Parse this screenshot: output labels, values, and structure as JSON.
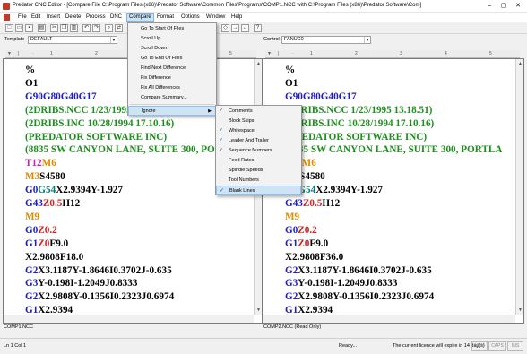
{
  "window": {
    "title": "Predator CNC Editor - [Compare File C:\\Program Files (x86)\\Predator Software\\Common Files\\Programs\\COMP1.NCC with C:\\Program Files (x86)\\Predator Software\\Com]",
    "controls": {
      "minimize": "–",
      "maximize": "▢",
      "close": "✕"
    }
  },
  "menubar": {
    "items": [
      "File",
      "Edit",
      "Insert",
      "Delete",
      "Process",
      "DNC",
      "Compare",
      "Format",
      "Options",
      "Window",
      "Help"
    ],
    "active": "Compare"
  },
  "toolbar": {
    "buttons": [
      "new",
      "open",
      "save",
      "print",
      "cut",
      "copy",
      "paste",
      "undo",
      "redo",
      "find",
      "replace",
      "renumber",
      "compare",
      "backplot",
      "send",
      "receive",
      "help"
    ]
  },
  "template": {
    "label": "Template",
    "value": "DEFAULT",
    "control_label": "Control",
    "control_value": "FANUC0"
  },
  "compare_menu": {
    "items": [
      "Go To Start Of Files",
      "Scroll Up",
      "Scroll Down",
      "Go To End Of Files",
      "Find Next Difference",
      "Fix Difference",
      "Fix All Differences",
      "Compare Summary...",
      "Ignore"
    ],
    "highlighted": "Ignore"
  },
  "ignore_submenu": {
    "items": [
      {
        "label": "Comments",
        "checked": true
      },
      {
        "label": "Block Skips",
        "checked": false
      },
      {
        "label": "Whitespace",
        "checked": true
      },
      {
        "label": "Leader And Trailer",
        "checked": true
      },
      {
        "label": "Sequence Numbers",
        "checked": true
      },
      {
        "label": "Feed Rates",
        "checked": false
      },
      {
        "label": "Spindle Speeds",
        "checked": false
      },
      {
        "label": "Tool Numbers",
        "checked": false
      },
      {
        "label": "Blank Lines",
        "checked": true
      }
    ],
    "highlighted": "Blank Lines"
  },
  "colors": {
    "default": "#000000",
    "blue": "#1c1cc8",
    "green": "#1f8f1f",
    "magenta": "#c81ec8",
    "red": "#d21e1e",
    "orange": "#e08a00",
    "teal": "#007a7a",
    "menu_highlight": "#cce4f7"
  },
  "left_file": {
    "label": "COMP1.NCC",
    "lines": [
      [
        {
          "t": "%",
          "c": "default"
        }
      ],
      [
        {
          "t": "O1",
          "c": "default"
        }
      ],
      [
        {
          "t": "G90G80G40G17",
          "c": "blue"
        }
      ],
      [
        {
          "t": "(2DRIBS.NCC 1/23/1995 13.18.51)",
          "c": "green"
        }
      ],
      [
        {
          "t": "(2DRIBS.INC 10/28/1994 17.10.16)",
          "c": "green"
        }
      ],
      [
        {
          "t": "(PREDATOR SOFTWARE INC)",
          "c": "green"
        }
      ],
      [
        {
          "t": "(8835 SW CANYON LANE, SUITE 300, PORTLA",
          "c": "green"
        }
      ],
      [
        {
          "t": "T12",
          "c": "magenta"
        },
        {
          "t": "M6",
          "c": "orange"
        }
      ],
      [
        {
          "t": "M3",
          "c": "orange"
        },
        {
          "t": "S4580",
          "c": "default"
        }
      ],
      [
        {
          "t": "G0",
          "c": "blue"
        },
        {
          "t": "G54",
          "c": "teal"
        },
        {
          "t": "X2.9394Y-1.927",
          "c": "default"
        }
      ],
      [
        {
          "t": "G43",
          "c": "blue"
        },
        {
          "t": "Z0.5",
          "c": "red"
        },
        {
          "t": "H12",
          "c": "default"
        }
      ],
      [
        {
          "t": "M9",
          "c": "orange"
        }
      ],
      [
        {
          "t": "G0",
          "c": "blue"
        },
        {
          "t": "Z0.2",
          "c": "red"
        }
      ],
      [
        {
          "t": "G1",
          "c": "blue"
        },
        {
          "t": "Z0",
          "c": "red"
        },
        {
          "t": "F9.0",
          "c": "default"
        }
      ],
      [
        {
          "t": "X2.9808F18.0",
          "c": "default"
        }
      ],
      [
        {
          "t": "G2",
          "c": "blue"
        },
        {
          "t": "X3.1187Y-1.8646I0.3702J-0.635",
          "c": "default"
        }
      ],
      [
        {
          "t": "G3",
          "c": "blue"
        },
        {
          "t": "Y-0.198I-1.2049J0.8333",
          "c": "default"
        }
      ],
      [
        {
          "t": "G2",
          "c": "blue"
        },
        {
          "t": "X2.9808Y-0.1356I0.2323J0.6974",
          "c": "default"
        }
      ],
      [
        {
          "t": "G1",
          "c": "blue"
        },
        {
          "t": "X2.9394",
          "c": "default"
        }
      ]
    ]
  },
  "right_file": {
    "label": "COMP2.NCC (Read Only)",
    "lines": [
      [
        {
          "t": "%",
          "c": "default"
        }
      ],
      [
        {
          "t": "O1",
          "c": "default"
        }
      ],
      [
        {
          "t": "G90G80G40G17",
          "c": "blue"
        }
      ],
      [
        {
          "t": "(2DRIBS.NCC 1/23/1995 13.18.51)",
          "c": "green"
        }
      ],
      [
        {
          "t": "(2DRIBS.INC 10/28/1994 17.10.16)",
          "c": "green"
        }
      ],
      [
        {
          "t": "(PREDATOR SOFTWARE INC)",
          "c": "green"
        }
      ],
      [
        {
          "t": "(8835 SW CANYON LANE, SUITE 300, PORTLA",
          "c": "green"
        }
      ],
      [
        {
          "t": "T12",
          "c": "magenta"
        },
        {
          "t": "M6",
          "c": "orange"
        }
      ],
      [
        {
          "t": "M3",
          "c": "orange"
        },
        {
          "t": "S4580",
          "c": "default"
        }
      ],
      [
        {
          "t": "G0",
          "c": "blue"
        },
        {
          "t": "G54",
          "c": "teal"
        },
        {
          "t": "X2.9394Y-1.927",
          "c": "default"
        }
      ],
      [
        {
          "t": "G43",
          "c": "blue"
        },
        {
          "t": "Z0.5",
          "c": "red"
        },
        {
          "t": "H12",
          "c": "default"
        }
      ],
      [
        {
          "t": "M9",
          "c": "orange"
        }
      ],
      [
        {
          "t": "G0",
          "c": "blue"
        },
        {
          "t": "Z0.2",
          "c": "red"
        }
      ],
      [
        {
          "t": "G1",
          "c": "blue"
        },
        {
          "t": "Z0",
          "c": "red"
        },
        {
          "t": "F9.0",
          "c": "default"
        }
      ],
      [
        {
          "t": "X2.9808F36.0",
          "c": "default"
        }
      ],
      [
        {
          "t": "G2",
          "c": "blue"
        },
        {
          "t": "X3.1187Y-1.8646I0.3702J-0.635",
          "c": "default"
        }
      ],
      [
        {
          "t": "G3",
          "c": "blue"
        },
        {
          "t": "Y-0.198I-1.2049J0.8333",
          "c": "default"
        }
      ],
      [
        {
          "t": "G2",
          "c": "blue"
        },
        {
          "t": "X2.9808Y-0.1356I0.2323J0.6974",
          "c": "default"
        }
      ],
      [
        {
          "t": "G1",
          "c": "blue"
        },
        {
          "t": "X2.9394",
          "c": "default"
        }
      ]
    ]
  },
  "status": {
    "position": "Ln 1 Col 1",
    "ready": "Ready...",
    "licence": "The current licence will expire in 14 day(s)",
    "num": "NUM",
    "caps": "CAPS",
    "ins": "INS"
  }
}
